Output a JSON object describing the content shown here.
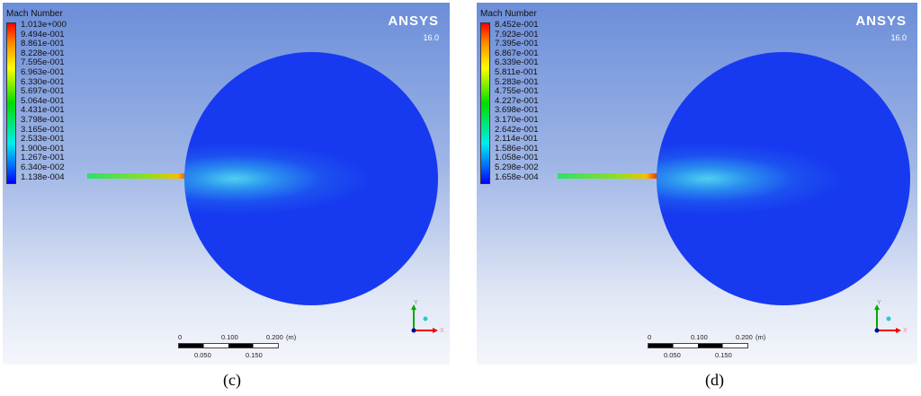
{
  "panels": [
    {
      "caption": "(c)",
      "legend_title": "Mach Number",
      "brand": "ANSYS",
      "version": "16.0",
      "legend_values": [
        "1.013e+000",
        "9.494e-001",
        "8.861e-001",
        "8.228e-001",
        "7.595e-001",
        "6.963e-001",
        "6.330e-001",
        "5.697e-001",
        "5.064e-001",
        "4.431e-001",
        "3.798e-001",
        "3.165e-001",
        "2.533e-001",
        "1.900e-001",
        "1.267e-001",
        "6.340e-002",
        "1.138e-004"
      ],
      "scale": {
        "top": [
          "0",
          "0.100",
          "0.200",
          "(m)"
        ],
        "bottom": [
          "0.050",
          "0.150"
        ]
      },
      "axes": {
        "x": "X",
        "y": "Y"
      }
    },
    {
      "caption": "(d)",
      "legend_title": "Mach Number",
      "brand": "ANSYS",
      "version": "16.0",
      "legend_values": [
        "8.452e-001",
        "7.923e-001",
        "7.395e-001",
        "6.867e-001",
        "6.339e-001",
        "5.811e-001",
        "5.283e-001",
        "4.755e-001",
        "4.227e-001",
        "3.698e-001",
        "3.170e-001",
        "2.642e-001",
        "2.114e-001",
        "1.586e-001",
        "1.058e-001",
        "5.298e-002",
        "1.658e-004"
      ],
      "scale": {
        "top": [
          "0",
          "0.100",
          "0.200",
          "(m)"
        ],
        "bottom": [
          "0.050",
          "0.150"
        ]
      },
      "axes": {
        "x": "X",
        "y": "Y"
      }
    }
  ]
}
